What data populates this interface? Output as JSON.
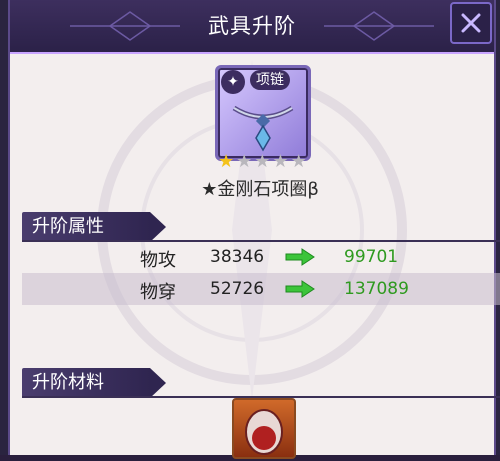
{
  "window": {
    "title": "武具升阶"
  },
  "item": {
    "type_badge": "项链",
    "name": "★金刚石项圈β",
    "stars_total": 5,
    "stars_filled": 1
  },
  "sections": {
    "attributes": "升阶属性",
    "materials": "升阶材料"
  },
  "stats": [
    {
      "label": "物攻",
      "old": "38346",
      "new": "99701"
    },
    {
      "label": "物穿",
      "old": "52726",
      "new": "137089"
    }
  ],
  "colors": {
    "increase": "#2f9a20",
    "star": "#f4c21a",
    "header": "#2b2148"
  },
  "icons": [
    "close-icon",
    "necklace-type-icon",
    "arrow-right-icon",
    "star-icon",
    "material-gem-icon"
  ]
}
